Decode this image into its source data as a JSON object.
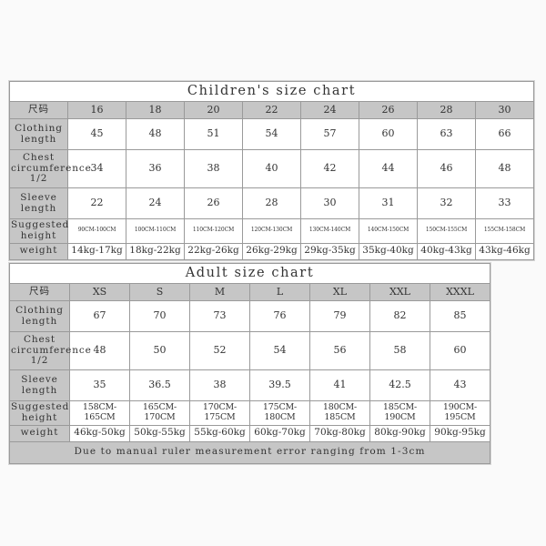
{
  "background_color": "#fafafa",
  "header_fill": "#c6c6c6",
  "cell_fill": "#ffffff",
  "border_color": "#9a9a9a",
  "children": {
    "title": "Children's size chart",
    "size_label": "尺码",
    "sizes": [
      "16",
      "18",
      "20",
      "22",
      "24",
      "26",
      "28",
      "30"
    ],
    "rows": [
      {
        "label": "Clothing length",
        "values": [
          "45",
          "48",
          "51",
          "54",
          "57",
          "60",
          "63",
          "66"
        ]
      },
      {
        "label": "Chest circumference 1/2",
        "values": [
          "34",
          "36",
          "38",
          "40",
          "42",
          "44",
          "46",
          "48"
        ]
      },
      {
        "label": "Sleeve length",
        "values": [
          "22",
          "24",
          "26",
          "28",
          "30",
          "31",
          "32",
          "33"
        ]
      },
      {
        "label": "Suggested height",
        "values": [
          "90CM-100CM",
          "100CM-110CM",
          "110CM-120CM",
          "120CM-130CM",
          "130CM-140CM",
          "140CM-150CM",
          "150CM-155CM",
          "155CM-158CM"
        ]
      },
      {
        "label": "weight",
        "values": [
          "14kg-17kg",
          "18kg-22kg",
          "22kg-26kg",
          "26kg-29kg",
          "29kg-35kg",
          "35kg-40kg",
          "40kg-43kg",
          "43kg-46kg"
        ]
      }
    ]
  },
  "adult": {
    "title": "Adult size chart",
    "size_label": "尺码",
    "sizes": [
      "XS",
      "S",
      "M",
      "L",
      "XL",
      "XXL",
      "XXXL"
    ],
    "rows": [
      {
        "label": "Clothing length",
        "values": [
          "67",
          "70",
          "73",
          "76",
          "79",
          "82",
          "85"
        ]
      },
      {
        "label": "Chest circumference 1/2",
        "values": [
          "48",
          "50",
          "52",
          "54",
          "56",
          "58",
          "60"
        ]
      },
      {
        "label": "Sleeve length",
        "values": [
          "35",
          "36.5",
          "38",
          "39.5",
          "41",
          "42.5",
          "43"
        ]
      },
      {
        "label": "Suggested height",
        "values": [
          "158CM-165CM",
          "165CM-170CM",
          "170CM-175CM",
          "175CM-180CM",
          "180CM-185CM",
          "185CM-190CM",
          "190CM-195CM"
        ]
      },
      {
        "label": "weight",
        "values": [
          "46kg-50kg",
          "50kg-55kg",
          "55kg-60kg",
          "60kg-70kg",
          "70kg-80kg",
          "80kg-90kg",
          "90kg-95kg"
        ]
      }
    ],
    "note": "Due to manual ruler measurement error ranging from 1-3cm"
  }
}
